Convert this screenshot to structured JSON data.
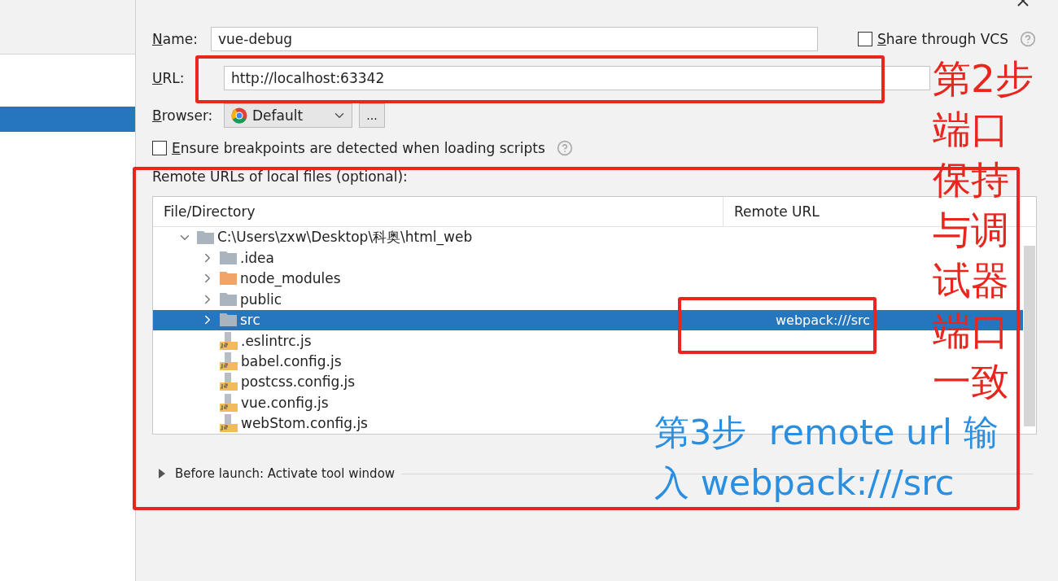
{
  "sidebar": {
    "items": [
      {
        "selected": false
      },
      {
        "selected": true
      }
    ]
  },
  "form": {
    "name_label": "Name:",
    "name_value": "vue-debug",
    "share": {
      "label": "Share through VCS",
      "checked": false
    },
    "url_label": "URL:",
    "url_value": "http://localhost:63342",
    "browser_label": "Browser:",
    "browser_value": "Default",
    "browser_more": "...",
    "ensure": {
      "label": "Ensure breakpoints are detected when loading scripts",
      "checked": false
    },
    "remote_label": "Remote URLs of local files (optional):"
  },
  "table": {
    "columns": [
      "File/Directory",
      "Remote URL"
    ],
    "rows": [
      {
        "kind": "folder",
        "name": "C:\\Users\\zxw\\Desktop\\科奥\\html_web",
        "expanded": true,
        "selected": false,
        "children": [
          {
            "kind": "folder",
            "name": ".idea",
            "expanded": false,
            "selected": false
          },
          {
            "kind": "excluded",
            "name": "node_modules",
            "expanded": false,
            "selected": false
          },
          {
            "kind": "folder",
            "name": "public",
            "expanded": false,
            "selected": false
          },
          {
            "kind": "folder",
            "name": "src",
            "expanded": false,
            "selected": true,
            "remote_url": "webpack:///src"
          },
          {
            "kind": "file",
            "name": ".eslintrc.js",
            "selected": false
          },
          {
            "kind": "file",
            "name": "babel.config.js",
            "selected": false
          },
          {
            "kind": "file",
            "name": "postcss.config.js",
            "selected": false
          },
          {
            "kind": "file",
            "name": "vue.config.js",
            "selected": false
          },
          {
            "kind": "file",
            "name": "webStom.config.js",
            "selected": false
          }
        ]
      }
    ]
  },
  "before_launch": {
    "label": "Before launch: Activate tool window",
    "expanded": false
  },
  "annotations": {
    "step2_title": "第2步",
    "step2_body": "端口保持与调试器端口一致",
    "step3": "第3步  remote url 输入 webpack:///src"
  }
}
